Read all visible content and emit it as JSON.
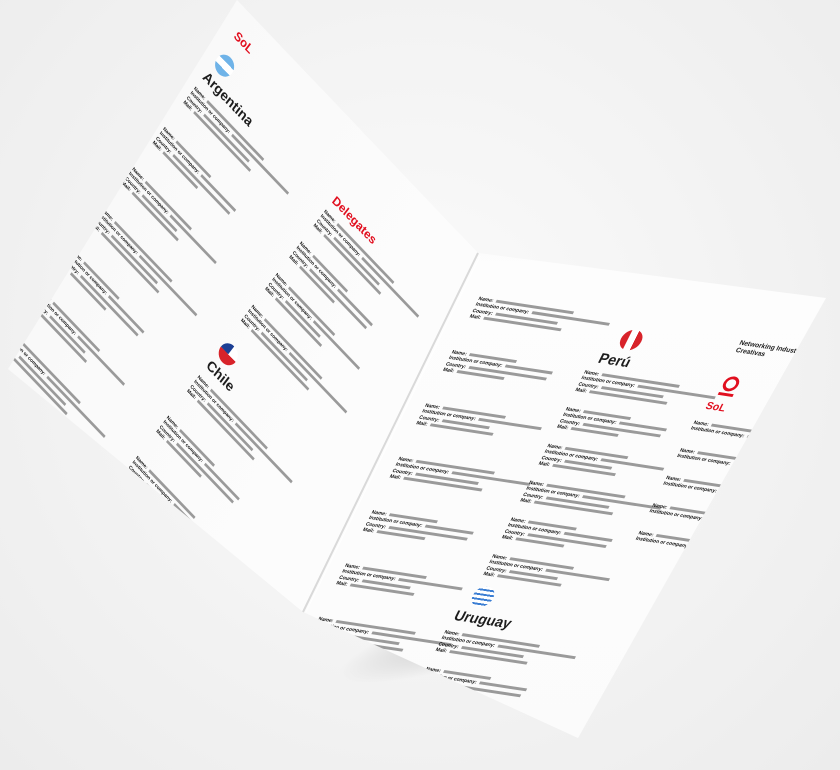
{
  "brand": "SoL",
  "left_page": {
    "section_title": "Delegates",
    "countries": [
      {
        "name": "Argentina",
        "flag": "argentina-flag",
        "entries": [
          {
            "name": "Name:",
            "inst": "Institution or company:",
            "country": "Country:",
            "mail": "Mail:"
          },
          {
            "name": "Name:",
            "inst": "Institution or company:",
            "country": "Country:",
            "mail": "Mail:"
          },
          {
            "name": "Name:",
            "inst": "Institution or company:",
            "country": "Country:",
            "mail": "Mail:"
          },
          {
            "name": "Name:",
            "inst": "Institution or company:",
            "country": "Country:",
            "mail": "Mail:"
          },
          {
            "name": "Name:",
            "inst": "Institution or company:",
            "country": "Country:",
            "mail": "Mail:"
          },
          {
            "name": "Name:",
            "inst": "Institution or company:",
            "country": "Country:",
            "mail": "Mail:"
          },
          {
            "name": "Name:",
            "inst": "Institution or company:",
            "country": "Country:",
            "mail": "Mail:"
          }
        ]
      },
      {
        "name": "Chile",
        "flag": "chile-flag",
        "entries": [
          {
            "name": "Name:",
            "inst": "Institution or company:",
            "country": "Country:",
            "mail": "Mail:"
          },
          {
            "name": "Name:",
            "inst": "Institution or company:",
            "country": "Country:",
            "mail": "Mail:"
          },
          {
            "name": "Name:",
            "inst": "Institution or company:",
            "country": "Country:",
            "mail": "Mail:"
          }
        ]
      }
    ],
    "column2_entries": [
      {
        "name": "Name:",
        "inst": "Institution or company:",
        "country": "Country:",
        "mail": "Mail:"
      },
      {
        "name": "Name:",
        "inst": "Institution or company:",
        "country": "Country:",
        "mail": "Mail:"
      },
      {
        "name": "Name:",
        "inst": "Institution or company:",
        "country": "Country:",
        "mail": "Mail:"
      },
      {
        "name": "Name:",
        "inst": "Institution or company:",
        "country": "Country:",
        "mail": "Mail:"
      }
    ]
  },
  "right_page": {
    "chile_cont_entries": [
      {
        "name": "Name:",
        "inst": "Institution or company:",
        "country": "Country:",
        "mail": "Mail:"
      },
      {
        "name": "Name:",
        "inst": "Institution or company:",
        "country": "Country:",
        "mail": "Mail:"
      },
      {
        "name": "Name:",
        "inst": "Institution or company:",
        "country": "Country:",
        "mail": "Mail:"
      },
      {
        "name": "Name:",
        "inst": "Institution or company:",
        "country": "Country:",
        "mail": "Mail:"
      },
      {
        "name": "Name:",
        "inst": "Institution or company:",
        "country": "Country:",
        "mail": "Mail:"
      },
      {
        "name": "Name:",
        "inst": "Institution or company:",
        "country": "Country:",
        "mail": "Mail:"
      },
      {
        "name": "Name:",
        "inst": "Institution or company:",
        "country": "Country:",
        "mail": "Mail:"
      }
    ],
    "peru": {
      "name": "Perú",
      "entries": [
        {
          "name": "Name:",
          "inst": "Institution or company:",
          "country": "Country:",
          "mail": "Mail:"
        },
        {
          "name": "Name:",
          "inst": "Institution or company:",
          "country": "Country:",
          "mail": "Mail:"
        },
        {
          "name": "Name:",
          "inst": "Institution or company:",
          "country": "Country:",
          "mail": "Mail:"
        },
        {
          "name": "Name:",
          "inst": "Institution or company:",
          "country": "Country:",
          "mail": "Mail:"
        },
        {
          "name": "Name:",
          "inst": "Institution or company:",
          "country": "Country:",
          "mail": "Mail:"
        },
        {
          "name": "Name:",
          "inst": "Institution or company:",
          "country": "Country:",
          "mail": "Mail:"
        }
      ]
    },
    "uruguay": {
      "name": "Uruguay",
      "entries": [
        {
          "name": "Name:",
          "inst": "Institution or company:",
          "country": "Country:",
          "mail": "Mail:"
        },
        {
          "name": "Name:",
          "inst": "Institution or company:",
          "country": "Country:",
          "mail": "Mail:"
        }
      ]
    },
    "networking": {
      "title": "Networking Industrias Creativas",
      "logo": "SoL",
      "entries": [
        {
          "name": "Name:",
          "inst": "Institution or company:"
        },
        {
          "name": "Name:",
          "inst": "Institution or company:"
        },
        {
          "name": "Name:",
          "inst": "Institution or company:"
        },
        {
          "name": "Name:",
          "inst": "Institution or company:"
        },
        {
          "name": "Name:",
          "inst": "Institution or company:"
        }
      ]
    }
  },
  "colors": {
    "accent": "#e10f1f",
    "text": "#1d1d1d"
  }
}
